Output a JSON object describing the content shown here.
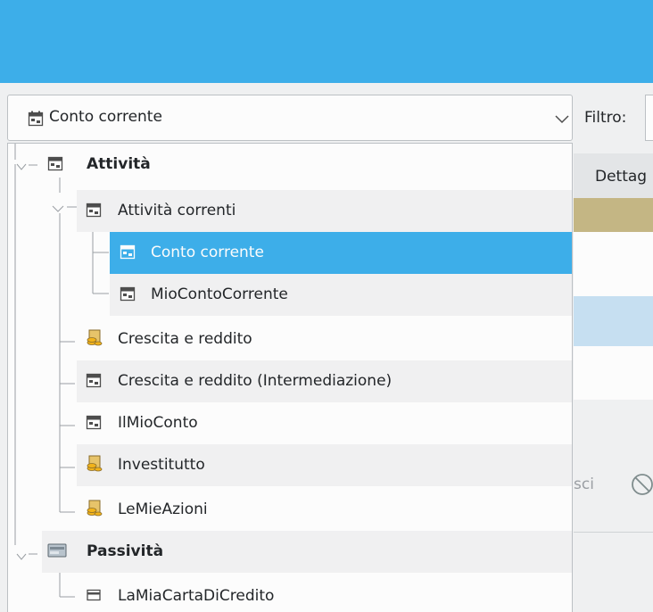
{
  "combo": {
    "selected": "Conto corrente"
  },
  "filter": {
    "label": "Filtro:"
  },
  "background": {
    "header_partial": "Dettag",
    "button_partial": "sci"
  },
  "tree": [
    {
      "label": "Attività",
      "icon": "account-asset-icon",
      "level": 0,
      "bold": true,
      "expanded": true
    },
    {
      "label": "Attività correnti",
      "icon": "account-asset-icon",
      "level": 1,
      "expanded": true
    },
    {
      "label": "Conto corrente",
      "icon": "account-asset-icon",
      "level": 2,
      "selected": true
    },
    {
      "label": "MioContoCorrente",
      "icon": "account-asset-icon",
      "level": 2
    },
    {
      "label": "Crescita e reddito",
      "icon": "investment-icon",
      "level": 1
    },
    {
      "label": "Crescita e reddito (Intermediazione)",
      "icon": "account-asset-icon",
      "level": 1
    },
    {
      "label": "IlMioConto",
      "icon": "account-asset-icon",
      "level": 1
    },
    {
      "label": "Investitutto",
      "icon": "investment-icon",
      "level": 1
    },
    {
      "label": "LeMieAzioni",
      "icon": "investment-icon",
      "level": 1
    },
    {
      "label": "Passività",
      "icon": "liability-icon",
      "level": 0,
      "bold": true,
      "expanded": true
    },
    {
      "label": "LaMiaCartaDiCredito",
      "icon": "credit-card-icon",
      "level": 1
    }
  ]
}
